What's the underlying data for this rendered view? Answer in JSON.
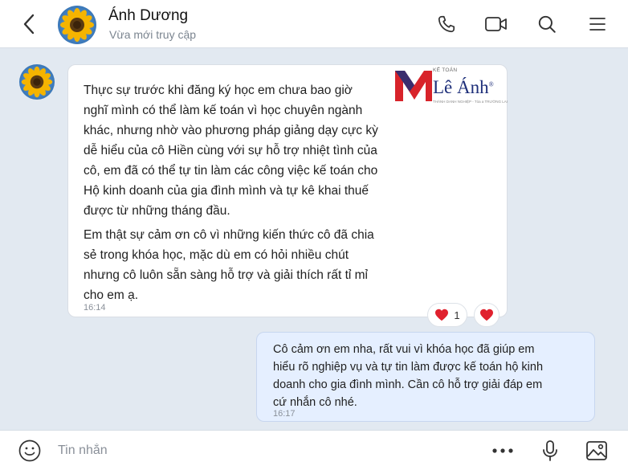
{
  "header": {
    "contact_name": "Ánh Dương",
    "status": "Vừa mới truy cập",
    "icons": [
      "back-icon",
      "phone-icon",
      "video-icon",
      "search-icon",
      "menu-icon"
    ]
  },
  "incoming_message": {
    "paragraph_1_lines": [
      "Thực sự trước khi đăng ký học em chưa bao giờ",
      "nghĩ mình có thể làm kế toán vì học chuyên ngành",
      "khác, nhưng nhờ vào phương pháp giảng dạy cực kỳ",
      "dễ hiểu của cô Hiền cùng với sự hỗ trợ nhiệt tình của",
      "cô, em đã có thể tự tin làm các công việc kế toán cho",
      "Hộ kinh doanh của gia đình mình và tự kê khai thuế",
      "được từ những tháng đầu."
    ],
    "paragraph_2_lines": [
      "Em thật sự cảm ơn cô vì những kiến thức cô đã chia",
      "sẻ trong khóa học, mặc dù em có hỏi nhiều chút",
      "nhưng cô luôn sẵn sàng hỗ trợ và giải thích rất tỉ mỉ",
      "cho em ạ."
    ],
    "time": "16:14",
    "reaction_count": "1"
  },
  "logo": {
    "top_text": "KẾ TOÁN",
    "name": "Lê Ánh",
    "registered": "®",
    "subtitle": "THÀNH DANH NGHIỆP - Tỏa a TRƯỜNG LAI"
  },
  "outgoing_message": {
    "lines": [
      "Cô cảm ơn em nha, rất vui vì khóa học đã giúp em",
      "hiểu rõ nghiệp vụ và tự tin làm được kế toán hộ kinh",
      "doanh cho gia đình mình. Cần cô hỗ trợ giải đáp em",
      "cứ nhắn cô nhé."
    ],
    "time": "16:17"
  },
  "input_bar": {
    "placeholder": "Tin nhắn",
    "icons": [
      "emoji-icon",
      "more-icon",
      "microphone-icon",
      "image-icon"
    ]
  },
  "colors": {
    "chat_background": "#e2e9f1",
    "outgoing_bubble": "#e5efff",
    "incoming_bubble": "#ffffff",
    "heart": "#e0212e",
    "logo_red": "#d8232a",
    "logo_navy": "#1e2f7a"
  }
}
